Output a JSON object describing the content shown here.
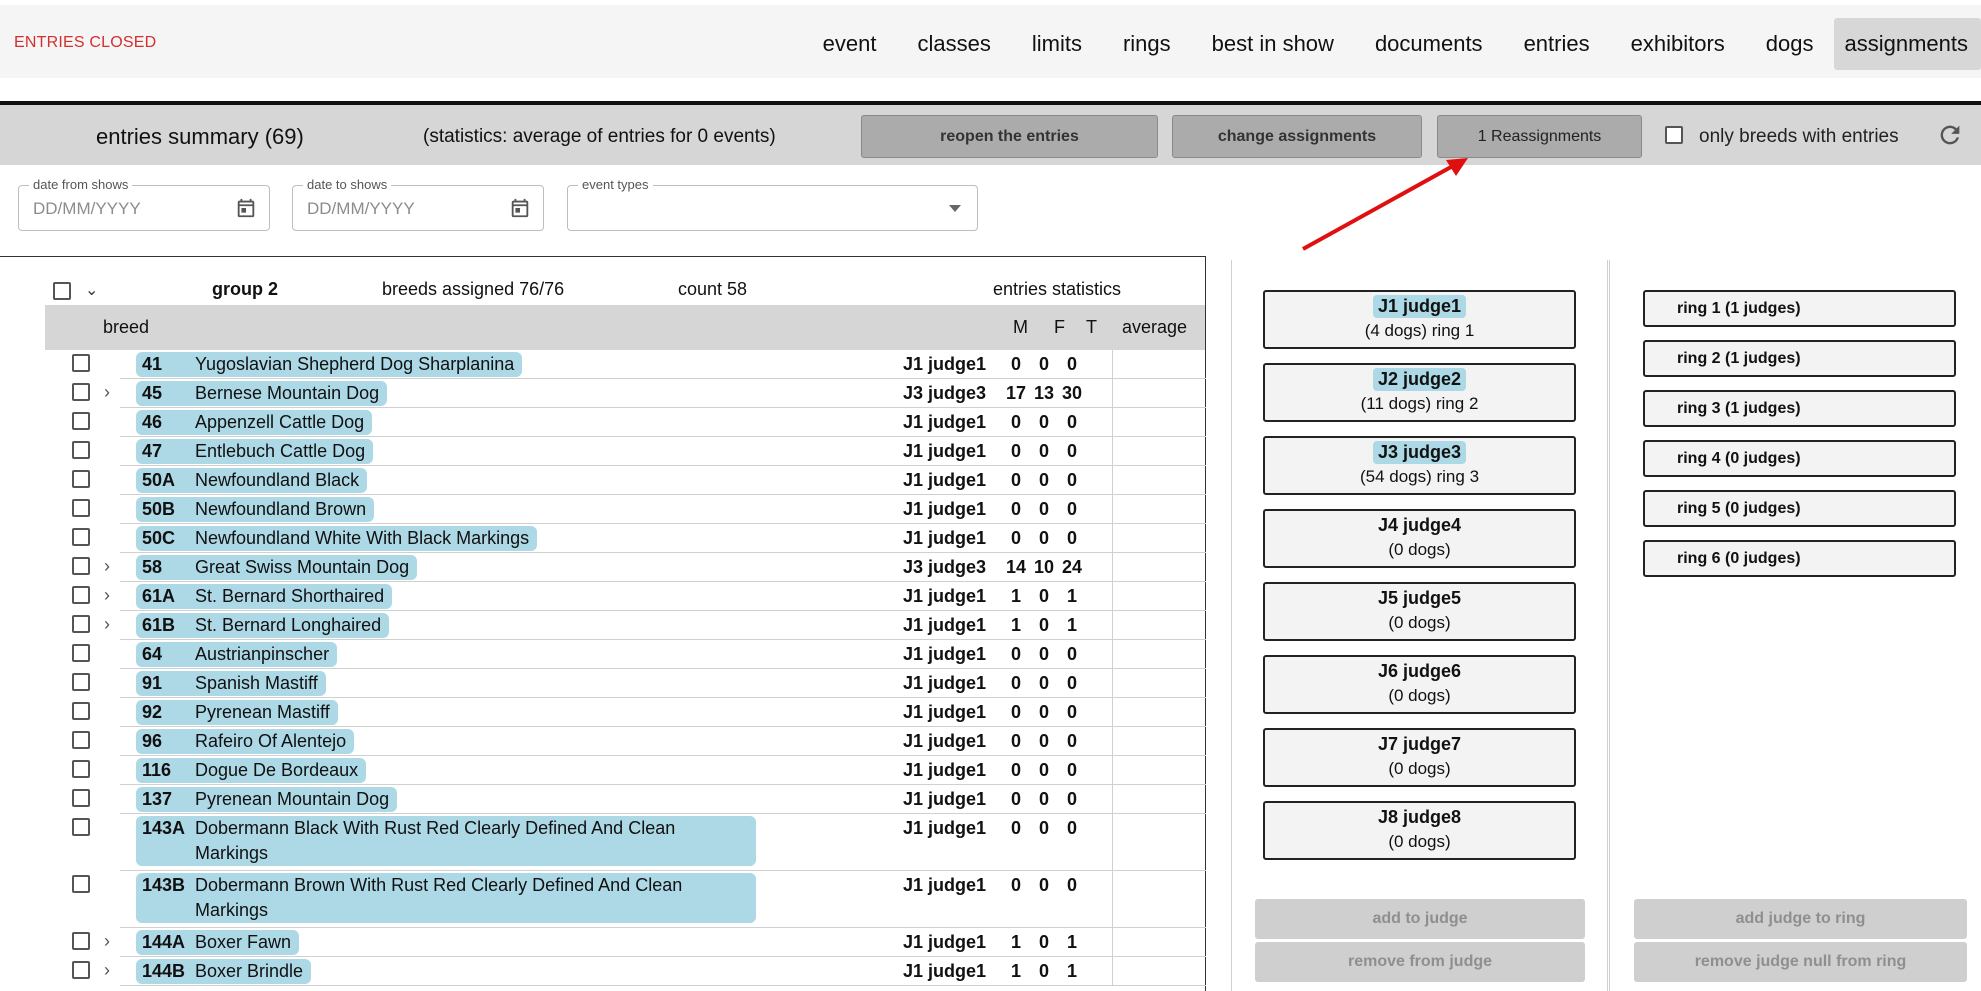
{
  "status": "ENTRIES CLOSED",
  "nav": [
    "event",
    "classes",
    "limits",
    "rings",
    "best in show",
    "documents",
    "entries",
    "exhibitors",
    "dogs",
    "assignments"
  ],
  "summary": {
    "title": "entries summary (69)",
    "stats": "(statistics: average of entries for 0 events)",
    "reopen": "reopen the entries",
    "change": "change assignments",
    "reassign": "1 Reassignments",
    "only_label": "only breeds with entries"
  },
  "filters": {
    "from_label": "date from shows",
    "to_label": "date to shows",
    "types_label": "event types",
    "date_placeholder": "DD/MM/YYYY"
  },
  "group": {
    "name": "group 2",
    "assigned": "breeds assigned 76/76",
    "count": "count 58",
    "stats_label": "entries statistics"
  },
  "table_headers": {
    "breed": "breed",
    "m": "M",
    "f": "F",
    "t": "T",
    "avg": "average"
  },
  "breeds": [
    {
      "num": "41",
      "name": "Yugoslavian Shepherd Dog Sharplanina",
      "judge": "J1 judge1",
      "m": "0",
      "f": "0",
      "t": "0",
      "exp": false
    },
    {
      "num": "45",
      "name": "Bernese Mountain Dog",
      "judge": "J3 judge3",
      "m": "17",
      "f": "13",
      "t": "30",
      "exp": true
    },
    {
      "num": "46",
      "name": "Appenzell Cattle Dog",
      "judge": "J1 judge1",
      "m": "0",
      "f": "0",
      "t": "0",
      "exp": false
    },
    {
      "num": "47",
      "name": "Entlebuch Cattle Dog",
      "judge": "J1 judge1",
      "m": "0",
      "f": "0",
      "t": "0",
      "exp": false
    },
    {
      "num": "50A",
      "name": "Newfoundland Black",
      "judge": "J1 judge1",
      "m": "0",
      "f": "0",
      "t": "0",
      "exp": false
    },
    {
      "num": "50B",
      "name": "Newfoundland Brown",
      "judge": "J1 judge1",
      "m": "0",
      "f": "0",
      "t": "0",
      "exp": false
    },
    {
      "num": "50C",
      "name": "Newfoundland White With Black Markings",
      "judge": "J1 judge1",
      "m": "0",
      "f": "0",
      "t": "0",
      "exp": false
    },
    {
      "num": "58",
      "name": "Great Swiss Mountain Dog",
      "judge": "J3 judge3",
      "m": "14",
      "f": "10",
      "t": "24",
      "exp": true
    },
    {
      "num": "61A",
      "name": "St. Bernard Shorthaired",
      "judge": "J1 judge1",
      "m": "1",
      "f": "0",
      "t": "1",
      "exp": true
    },
    {
      "num": "61B",
      "name": "St. Bernard Longhaired",
      "judge": "J1 judge1",
      "m": "1",
      "f": "0",
      "t": "1",
      "exp": true
    },
    {
      "num": "64",
      "name": "Austrianpinscher",
      "judge": "J1 judge1",
      "m": "0",
      "f": "0",
      "t": "0",
      "exp": false
    },
    {
      "num": "91",
      "name": "Spanish Mastiff",
      "judge": "J1 judge1",
      "m": "0",
      "f": "0",
      "t": "0",
      "exp": false
    },
    {
      "num": "92",
      "name": "Pyrenean Mastiff",
      "judge": "J1 judge1",
      "m": "0",
      "f": "0",
      "t": "0",
      "exp": false
    },
    {
      "num": "96",
      "name": "Rafeiro Of Alentejo",
      "judge": "J1 judge1",
      "m": "0",
      "f": "0",
      "t": "0",
      "exp": false
    },
    {
      "num": "116",
      "name": "Dogue De Bordeaux",
      "judge": "J1 judge1",
      "m": "0",
      "f": "0",
      "t": "0",
      "exp": false
    },
    {
      "num": "137",
      "name": "Pyrenean Mountain Dog",
      "judge": "J1 judge1",
      "m": "0",
      "f": "0",
      "t": "0",
      "exp": false
    },
    {
      "num": "143A",
      "name": "Dobermann Black With Rust Red Clearly Defined And Clean Markings",
      "judge": "J1 judge1",
      "m": "0",
      "f": "0",
      "t": "0",
      "exp": false
    },
    {
      "num": "143B",
      "name": "Dobermann Brown With Rust Red Clearly Defined And Clean Markings",
      "judge": "J1 judge1",
      "m": "0",
      "f": "0",
      "t": "0",
      "exp": false
    },
    {
      "num": "144A",
      "name": "Boxer Fawn",
      "judge": "J1 judge1",
      "m": "1",
      "f": "0",
      "t": "1",
      "exp": true
    },
    {
      "num": "144B",
      "name": "Boxer Brindle",
      "judge": "J1 judge1",
      "m": "1",
      "f": "0",
      "t": "1",
      "exp": true
    }
  ],
  "judges": [
    {
      "name": "J1 judge1",
      "sub": "(4 dogs) ring 1",
      "hl": true
    },
    {
      "name": "J2 judge2",
      "sub": "(11 dogs) ring 2",
      "hl": true
    },
    {
      "name": "J3 judge3",
      "sub": "(54 dogs) ring 3",
      "hl": true
    },
    {
      "name": "J4 judge4",
      "sub": "(0 dogs)",
      "hl": false
    },
    {
      "name": "J5 judge5",
      "sub": "(0 dogs)",
      "hl": false
    },
    {
      "name": "J6 judge6",
      "sub": "(0 dogs)",
      "hl": false
    },
    {
      "name": "J7 judge7",
      "sub": "(0 dogs)",
      "hl": false
    },
    {
      "name": "J8 judge8",
      "sub": "(0 dogs)",
      "hl": false
    }
  ],
  "rings": [
    "ring 1 (1 judges)",
    "ring 2 (1 judges)",
    "ring 3 (1 judges)",
    "ring 4 (0 judges)",
    "ring 5 (0 judges)",
    "ring 6 (0 judges)"
  ],
  "actions": {
    "add_to_judge": "add to judge",
    "remove_from_judge": "remove from judge",
    "add_judge_to_ring": "add judge to ring",
    "remove_judge_from_ring": "remove judge null from ring"
  },
  "colors": {
    "status": "#d32f2f",
    "highlight": "#add8e6",
    "annotation_arrow": "#e01010"
  }
}
